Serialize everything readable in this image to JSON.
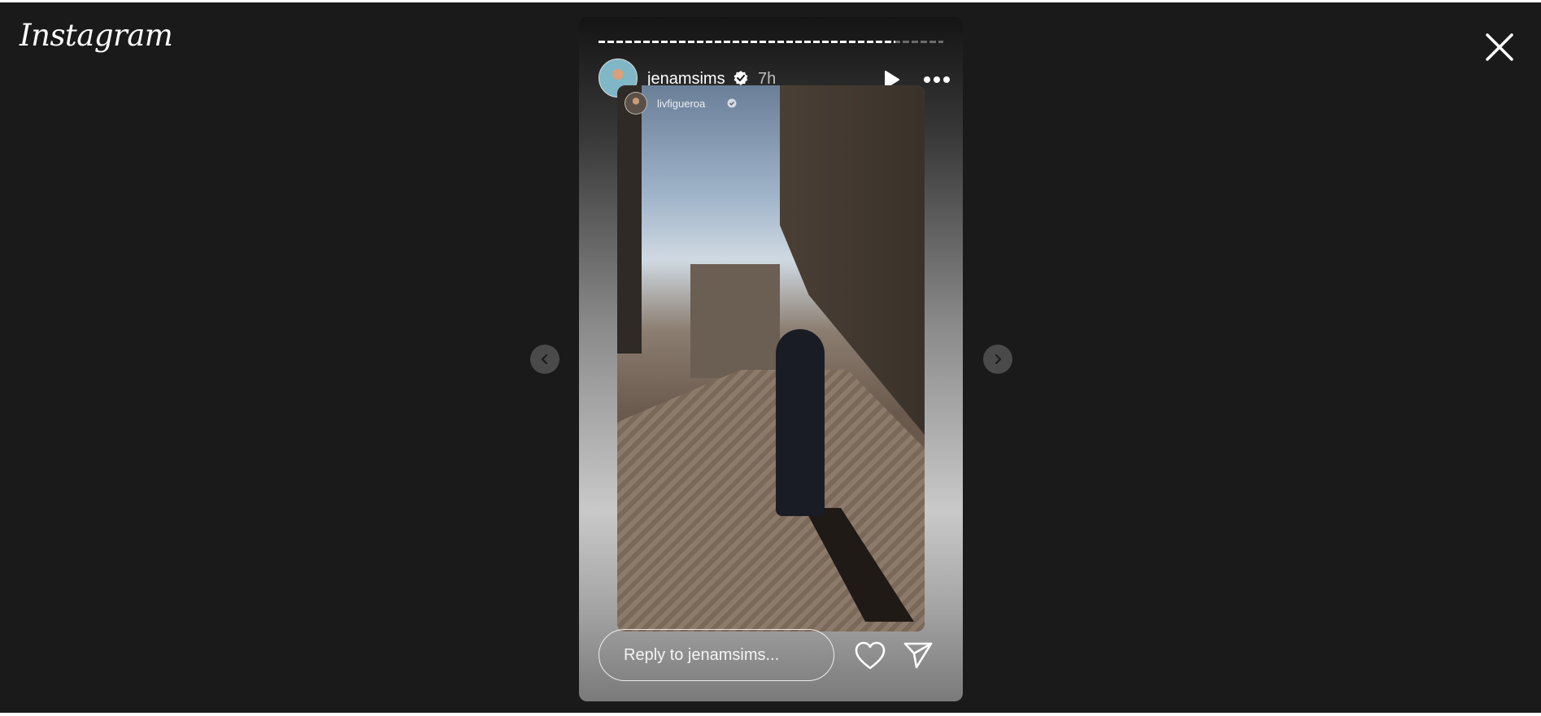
{
  "app": {
    "logo_text": "Instagram"
  },
  "story": {
    "username": "jenamsims",
    "time_ago": "7h",
    "progress": 0.86,
    "tagged_account": "livfigueroa",
    "reply_placeholder": "Reply to jenamsims..."
  },
  "icons": {
    "close": "close-icon",
    "prev": "chevron-left-icon",
    "next": "chevron-right-icon",
    "play": "play-icon",
    "more": "more-icon",
    "verified": "verified-badge-icon",
    "like": "heart-icon",
    "share": "send-icon"
  }
}
